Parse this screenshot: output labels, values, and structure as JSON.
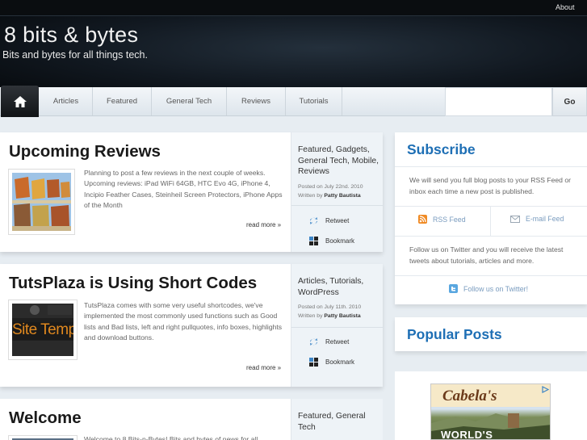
{
  "header": {
    "title": "8 bits & bytes",
    "tagline": "Bits and bytes for all things tech.",
    "top_links": [
      "About",
      ""
    ]
  },
  "nav": {
    "home_icon": "home-icon",
    "items": [
      "Articles",
      "Featured",
      "General Tech",
      "Reviews",
      "Tutorials"
    ],
    "search_placeholder": "",
    "search_button": "Go"
  },
  "posts": [
    {
      "title": "Upcoming Reviews",
      "excerpt": "Planning to post a few reviews in the next couple of weeks. Upcoming reviews: iPad WiFi 64GB, HTC Evo 4G, iPhone 4, Incipio Feather Cases, Steinheil Screen Protectors, iPhone Apps of the Month",
      "read_more": "read more »",
      "categories": "Featured, Gadgets, General Tech, Mobile, Reviews",
      "posted_on": "Posted on July 22nd. 2010",
      "written_by_label": "Written by",
      "author": "Patty Bautista",
      "retweet": "Retweet",
      "bookmark": "Bookmark"
    },
    {
      "title": "TutsPlaza is Using Short Codes",
      "excerpt": "TutsPlaza comes with some very useful shortcodes, we've implemented the most commonly used functions such as Good lists and Bad lists, left and right pullquotes, info boxes, highlights and download buttons.",
      "thumb_text": "Site Templ",
      "read_more": "read more »",
      "categories": "Articles, Tutorials, WordPress",
      "posted_on": "Posted on July 11th. 2010",
      "written_by_label": "Written by",
      "author": "Patty Bautista",
      "retweet": "Retweet",
      "bookmark": "Bookmark"
    },
    {
      "title": "Welcome",
      "excerpt": "Welcome to 8 Bits-n-Bytes! Bits and bytes of news for all",
      "categories": "Featured, General Tech"
    }
  ],
  "sidebar": {
    "subscribe": {
      "title": "Subscribe",
      "text": "We will send you full blog posts to your RSS Feed or inbox each time a new post is published.",
      "rss_label": "RSS Feed",
      "email_label": "E-mail Feed",
      "twitter_text": "Follow us on Twitter and you will receive the latest tweets about tutorials, articles and more.",
      "twitter_link": "Follow us on Twitter!"
    },
    "popular": {
      "title": "Popular Posts"
    },
    "ad": {
      "brand": "Cabela's",
      "text": "WORLD'S"
    }
  },
  "colors": {
    "accent": "#1e6fb5",
    "header_bg": "#111820",
    "page_bg": "#e7edf2"
  }
}
